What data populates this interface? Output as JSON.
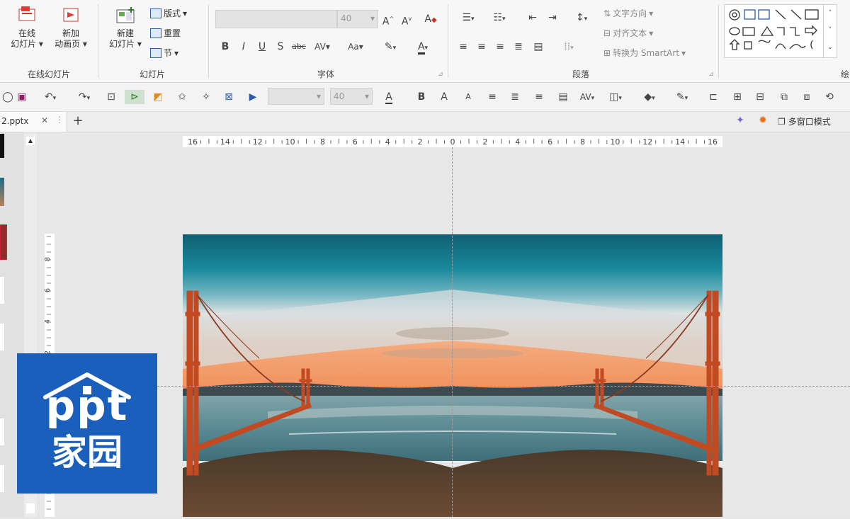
{
  "ribbon": {
    "groups": {
      "online_slides": "在线幻灯片",
      "slides": "幻灯片",
      "font": "字体",
      "paragraph": "段落",
      "drawing_partial": "绘"
    },
    "buttons": {
      "online_slide_1": "在线",
      "online_slide_2": "幻灯片",
      "new_anim_1": "新加",
      "new_anim_2": "动画页",
      "new_slide_1": "新建",
      "new_slide_2": "幻灯片",
      "layout": "版式",
      "reset": "重置",
      "section": "节",
      "text_direction": "文字方向",
      "align_text": "对齐文本",
      "convert_smartart": "转换为 SmartArt"
    },
    "font_size": "40",
    "font_buttons": [
      "B",
      "I",
      "U",
      "S",
      "abc",
      "AV",
      "Aa"
    ]
  },
  "qat": {
    "font_size": "40"
  },
  "tabbar": {
    "doc_tab": "2.pptx",
    "close": "✕",
    "add": "+",
    "multi_window": "多窗口模式"
  },
  "ruler": {
    "h_ticks": [
      "16",
      "14",
      "12",
      "10",
      "8",
      "6",
      "4",
      "2",
      "0",
      "2",
      "4",
      "6",
      "8",
      "10",
      "12",
      "14",
      "16"
    ],
    "v_ticks": [
      "8",
      "6",
      "4",
      "2"
    ]
  },
  "logo": {
    "line1": "ppt",
    "line2": "家园"
  },
  "colors": {
    "accent_blue": "#1b5fbd",
    "ribbon_bg": "#f7f7f7",
    "canvas_bg": "#e8e8e8"
  }
}
